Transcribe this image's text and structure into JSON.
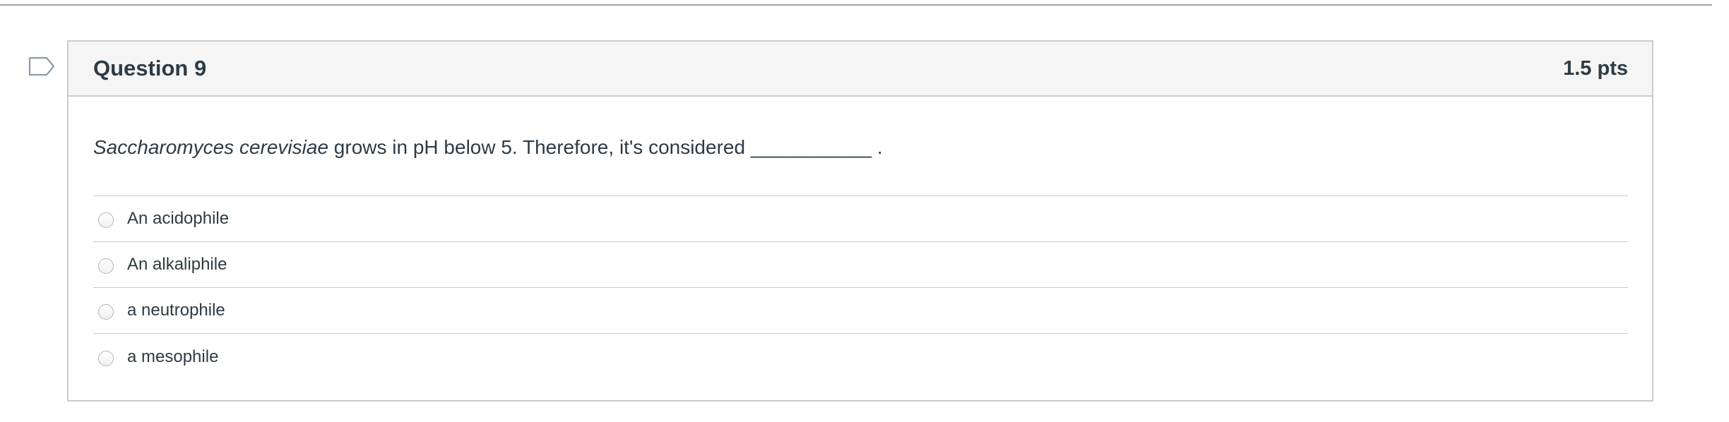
{
  "question": {
    "title": "Question 9",
    "points": "1.5 pts",
    "text_italic": "Saccharomyces cerevisiae",
    "text_rest": " grows in pH below 5. Therefore, it's considered ___________ .",
    "answers": [
      {
        "label": "An acidophile",
        "selected": false
      },
      {
        "label": "An alkaliphile",
        "selected": false
      },
      {
        "label": "a neutrophile",
        "selected": false
      },
      {
        "label": "a mesophile",
        "selected": false
      }
    ]
  },
  "icons": {
    "flag": "flag-outline-icon"
  },
  "colors": {
    "text": "#2d3b45",
    "border": "#c7cdd1",
    "header_bg": "#f5f5f5"
  }
}
